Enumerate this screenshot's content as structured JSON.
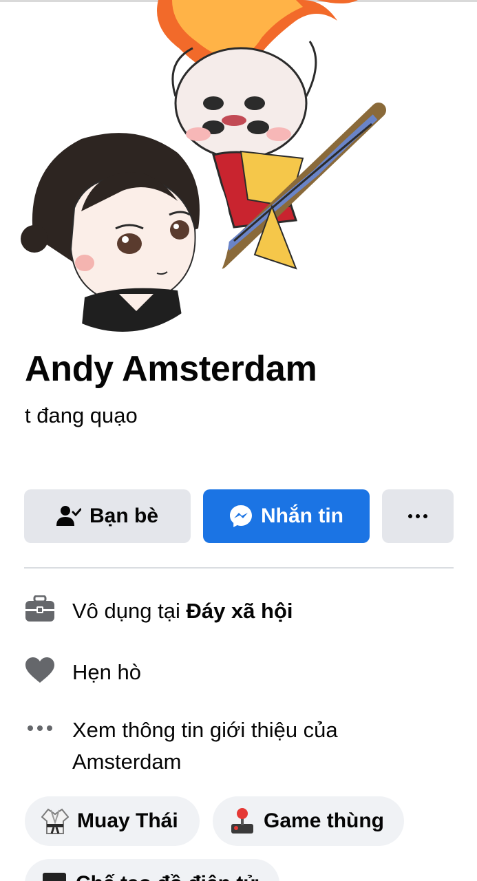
{
  "profile": {
    "name": "Andy Amsterdam",
    "bio": "t đang quạo"
  },
  "actions": {
    "friends_label": "Bạn bè",
    "message_label": "Nhắn tin",
    "more_icon": "more-dots-icon"
  },
  "info": {
    "work_prefix": "Vô dụng tại ",
    "work_place": "Đáy xã hội",
    "dating_label": "Hẹn hò",
    "about_label": "Xem thông tin giới thiệu của Amsterdam"
  },
  "hobbies": [
    {
      "label": "Muay Thái",
      "icon": "martial-arts-uniform-icon"
    },
    {
      "label": "Game thùng",
      "icon": "joystick-icon"
    },
    {
      "label": "Chế tạo đồ điện tử",
      "icon": "electronics-icon"
    }
  ],
  "colors": {
    "primary": "#1b74e4",
    "button_gray": "#e4e6eb",
    "chip_bg": "#f0f2f5",
    "text": "#050505"
  }
}
